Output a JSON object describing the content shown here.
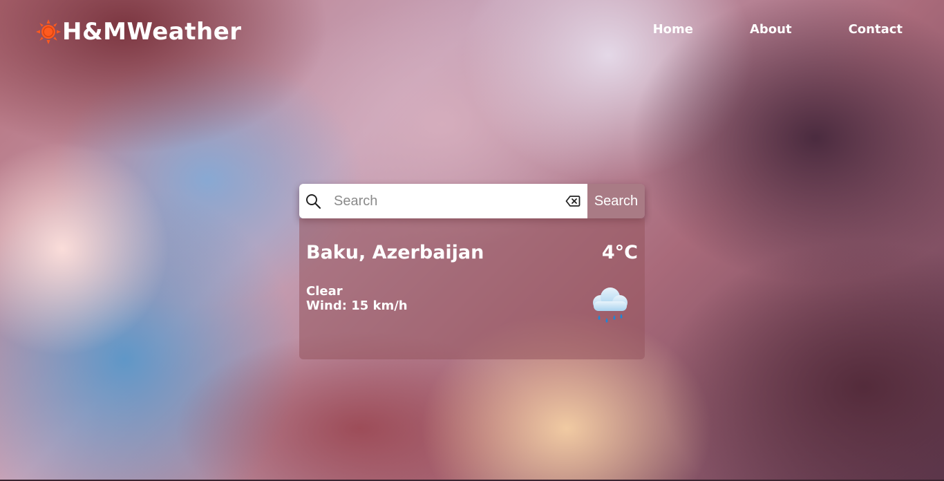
{
  "brand": {
    "name": "H&MWeather",
    "icon": "sun-icon",
    "icon_color": "#ff5a1f"
  },
  "nav": {
    "items": [
      {
        "label": "Home"
      },
      {
        "label": "About"
      },
      {
        "label": "Contact"
      }
    ]
  },
  "search": {
    "placeholder": "Search",
    "value": "",
    "button_label": "Search",
    "search_icon": "magnifier-icon",
    "clear_icon": "backspace-clear-icon",
    "button_color": "#a97b85"
  },
  "weather": {
    "location": "Baku, Azerbaijan",
    "temperature": "4°C",
    "condition": "Clear",
    "wind": "Wind: 15 km/h",
    "icon": "rain-cloud-icon"
  }
}
